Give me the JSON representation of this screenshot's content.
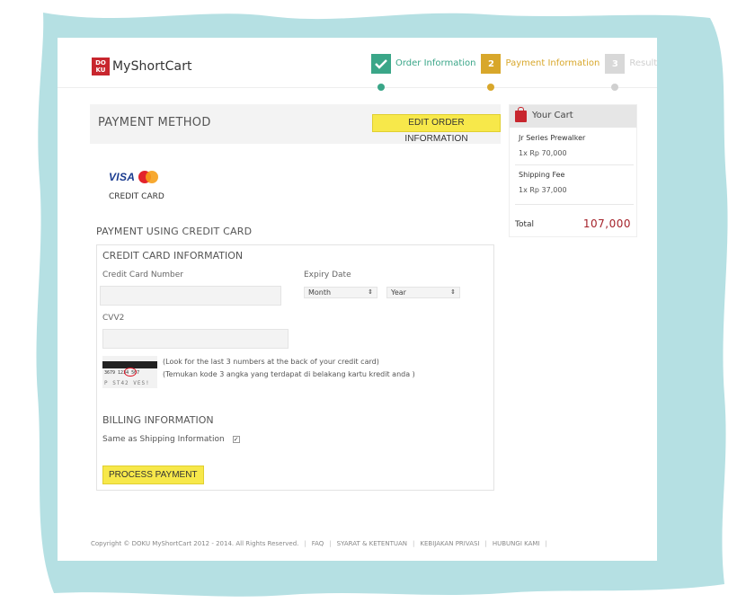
{
  "brand": {
    "logo_text": "DOKU",
    "name": "MyShortCart"
  },
  "steps": [
    {
      "number": "",
      "label": "Order Information",
      "state": "done",
      "color": "#3aa688"
    },
    {
      "number": "2",
      "label": "Payment Information",
      "state": "active",
      "color": "#d8a72b"
    },
    {
      "number": "3",
      "label": "Result",
      "state": "pending",
      "color": "#d0d0d0"
    }
  ],
  "main": {
    "title": "PAYMENT METHOD",
    "edit_button": "EDIT ORDER INFORMATION",
    "card_brands": {
      "visa": "VISA",
      "mastercard": "MasterCard"
    },
    "method_label": "CREDIT CARD",
    "section_title": "PAYMENT USING CREDIT CARD"
  },
  "cc_form": {
    "title": "CREDIT CARD INFORMATION",
    "card_number_label": "Credit Card Number",
    "card_number_value": "",
    "expiry_label": "Expiry Date",
    "month_value": "Month",
    "year_value": "Year",
    "cvv_label": "CVV2",
    "cvv_value": "",
    "cvv_image": {
      "digits": "3679 1234 567",
      "bottom": "P ST42 VES!"
    },
    "hint_en": "(Look for the last 3 numbers at the back of your credit card)",
    "hint_id": "(Temukan kode 3 angka yang terdapat di belakang kartu kredit anda )",
    "billing_title": "BILLING INFORMATION",
    "same_as_shipping_label": "Same as Shipping Information",
    "same_as_shipping_checked": true,
    "process_button": "PROCESS PAYMENT"
  },
  "cart": {
    "title": "Your Cart",
    "items": [
      {
        "name": "Jr Series Prewalker",
        "qty_price": "1x Rp 70,000"
      },
      {
        "name": "Shipping Fee",
        "qty_price": "1x Rp 37,000"
      }
    ],
    "total_label": "Total",
    "total_value": "107,000",
    "accent_color": "#a5222a"
  },
  "footer": {
    "copyright": "Copyright © DOKU MyShortCart 2012 - 2014. All Rights Reserved.",
    "links": [
      "FAQ",
      "SYARAT & KETENTUAN",
      "KEBIJAKAN PRIVASI",
      "HUBUNGI KAMI"
    ]
  },
  "colors": {
    "frame": "#b5e0e3",
    "highlight_button": "#f7e84a",
    "brand_red": "#c8262e"
  }
}
